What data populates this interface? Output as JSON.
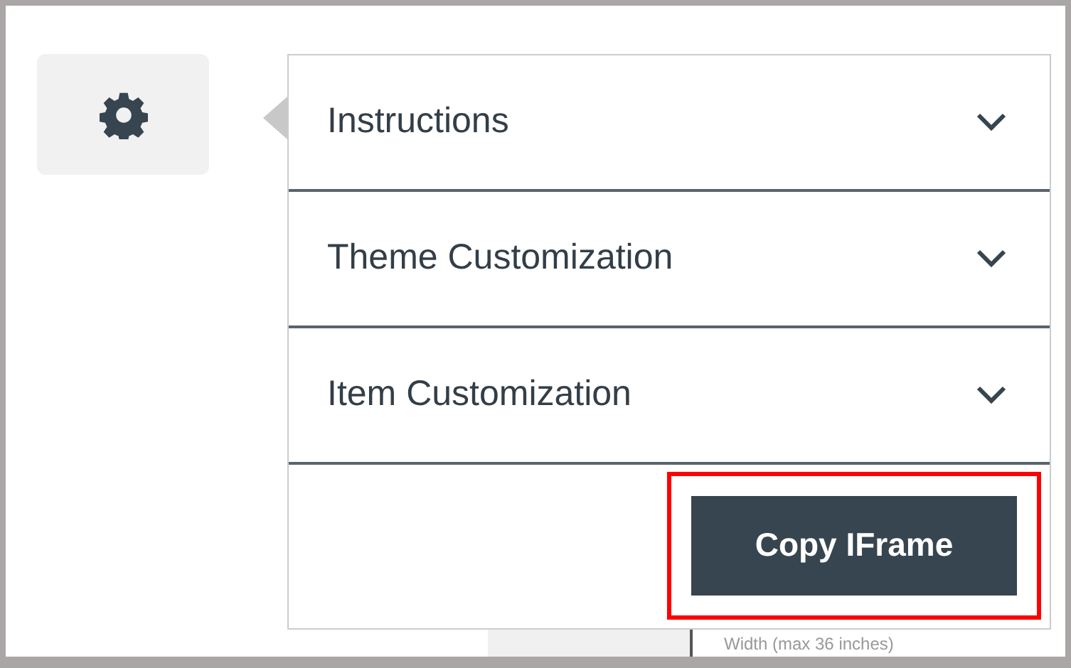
{
  "sections": [
    {
      "title": "Instructions",
      "expanded": false
    },
    {
      "title": "Theme Customization",
      "expanded": false
    },
    {
      "title": "Item Customization",
      "expanded": false
    }
  ],
  "copy_button": {
    "label": "Copy IFrame",
    "highlighted": true
  },
  "background_field": {
    "label": "Width (max 36 inches)"
  }
}
